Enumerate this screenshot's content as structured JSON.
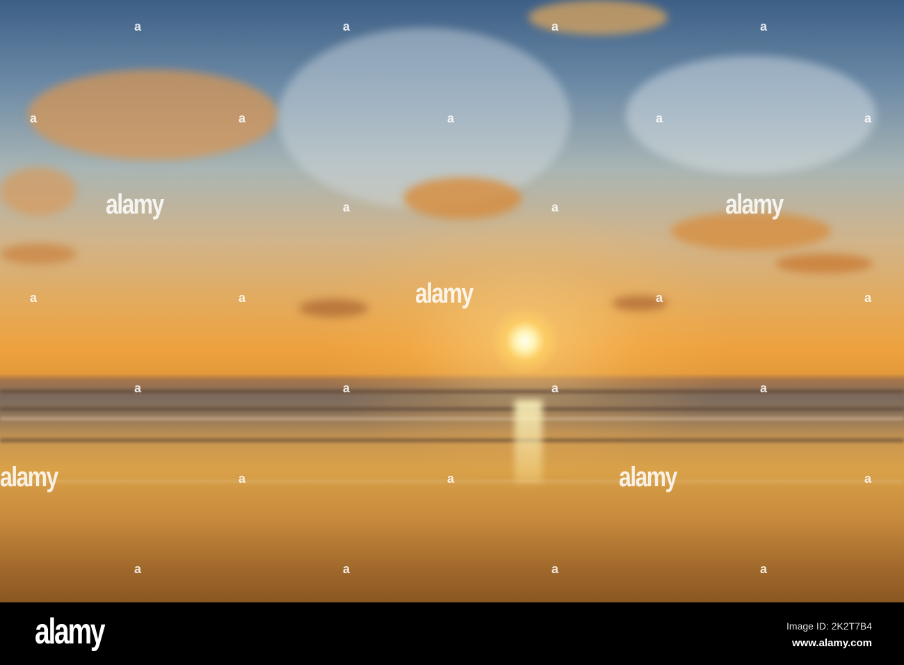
{
  "watermark": {
    "logo": "alamy",
    "mark": "a"
  },
  "footer": {
    "logo": "alamy",
    "image_id": "Image ID: 2K2T7B4",
    "url": "www.alamy.com"
  },
  "colors": {
    "sky_top": "#3d5f86",
    "horizon": "#eea13e",
    "sand": "#c88a3c",
    "footer": "#000000"
  }
}
